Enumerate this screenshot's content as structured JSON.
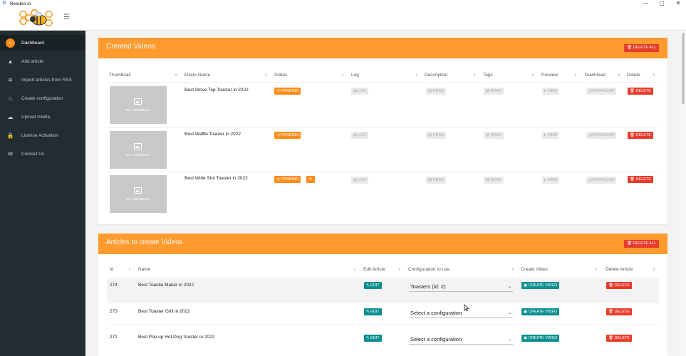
{
  "window": {
    "title": "Beedeo.io",
    "minimize": "—",
    "maximize": "▢",
    "close": "✕"
  },
  "header": {
    "menu_icon": "☰"
  },
  "sidebar": {
    "items": [
      {
        "label": "Dashboard",
        "icon": "⌂"
      },
      {
        "label": "Add article",
        "icon": "▲"
      },
      {
        "label": "Import articles from RSS",
        "icon": "≋"
      },
      {
        "label": "Create configuration",
        "icon": "♨"
      },
      {
        "label": "Upload media",
        "icon": "☁"
      },
      {
        "label": "License Activation",
        "icon": "🔒"
      },
      {
        "label": "Contact Us",
        "icon": "✉"
      }
    ]
  },
  "created_videos": {
    "title": "Created Videos",
    "delete_all": "🗑 DELETE ALL",
    "columns": [
      "Thumbnail",
      "Article Name",
      "Status",
      "Log",
      "Description",
      "Tags",
      "Preview",
      "Download",
      "Delete"
    ],
    "rows": [
      {
        "thumb_text": "NO THUMBNAIL",
        "article": "Best Stove Top Toaster in 2022",
        "status": "◷ PENDING",
        "log": "▤ LOG",
        "desc": "▤ READ",
        "tags": "▤ READ",
        "preview": "▸ VIEW",
        "download": "⤓ DOWNLOAD",
        "delete": "🗑 DELETE"
      },
      {
        "thumb_text": "NO THUMBNAIL",
        "article": "Best Waffle Toaster in 2022",
        "status": "◷ PENDING",
        "log": "▤ LOG",
        "desc": "▤ READ",
        "tags": "▤ READ",
        "preview": "▸ VIEW",
        "download": "⤓ DOWNLOAD",
        "delete": "🗑 DELETE"
      },
      {
        "thumb_text": "NO THUMBNAIL",
        "article": "Best Wide Slot Toaster in 2022",
        "status": "◷ PENDING",
        "refresh": "↻",
        "log": "▤ LOG",
        "desc": "▤ READ",
        "tags": "▤ READ",
        "preview": "▸ VIEW",
        "download": "⤓ DOWNLOAD",
        "delete": "🗑 DELETE"
      }
    ]
  },
  "articles": {
    "title": "Articles to create Videos",
    "delete_all": "🗑 DELETE ALL",
    "columns": [
      "Id",
      "Name",
      "Edit Article",
      "Configuration to use",
      "Create Video",
      "Delete Article"
    ],
    "rows": [
      {
        "id": "274",
        "name": "Best Toastie Maker in 2022",
        "edit": "✎ EDIT",
        "config": "Toasters (id: 2)",
        "create": "▣ CREATE VIDEO",
        "delete": "🗑 DELETE"
      },
      {
        "id": "273",
        "name": "Best Toaster Grill in 2022",
        "edit": "✎ EDIT",
        "config": "Select a configuration",
        "create": "▣ CREATE VIDEO",
        "delete": "🗑 DELETE"
      },
      {
        "id": "272",
        "name": "Best Pop up Hot Dog Toaster in 2022",
        "edit": "✎ EDIT",
        "config": "Select a configuration",
        "create": "▣ CREATE VIDEO",
        "delete": "🗑 DELETE"
      }
    ]
  },
  "colors": {
    "accent": "#ff9a2e",
    "sidebar": "#222d32",
    "danger": "#e83c2b",
    "teal": "#0b8f8f"
  }
}
